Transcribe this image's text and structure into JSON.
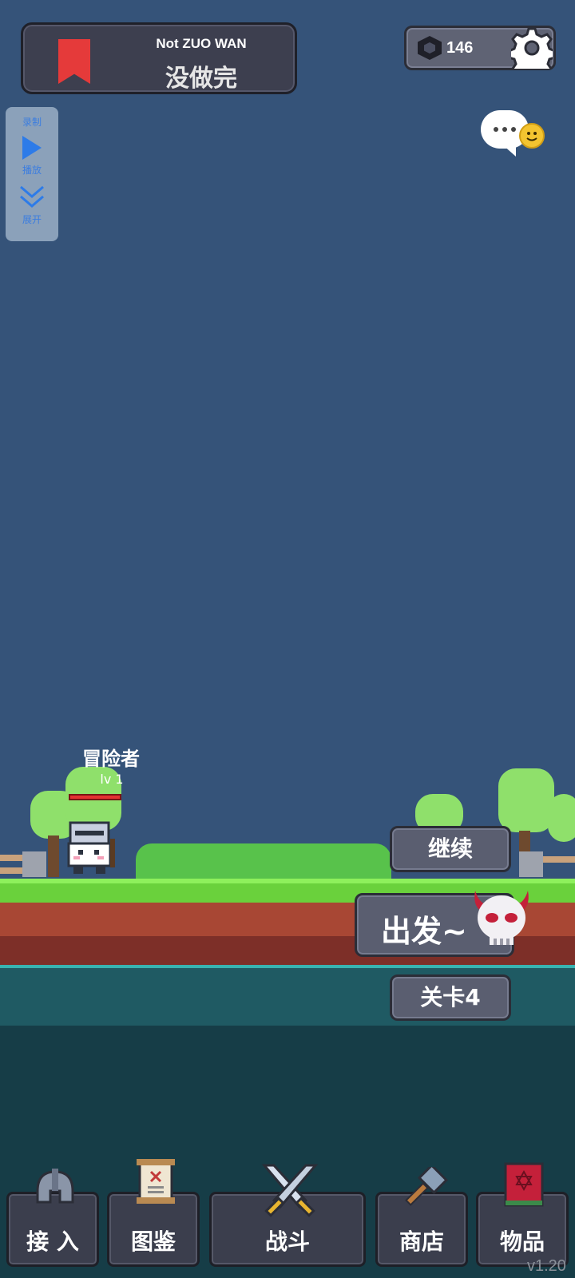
{
  "banner": {
    "subtitle": "Not ZUO WAN",
    "title": "没做完"
  },
  "currency": {
    "count": "146"
  },
  "recorder": {
    "record_label": "录制",
    "play_label": "播放",
    "expand_label": "展开"
  },
  "hero": {
    "name": "冒险者",
    "level": "lv 1"
  },
  "actions": {
    "continue_label": "继续",
    "depart_label": "出发~",
    "level_label": "关卡4"
  },
  "nav": {
    "items": [
      {
        "label": "接 入",
        "icon": "helmet-icon"
      },
      {
        "label": "图鉴",
        "icon": "scroll-icon"
      },
      {
        "label": "战斗",
        "icon": "crossed-swords-icon"
      },
      {
        "label": "商店",
        "icon": "hammer-icon"
      },
      {
        "label": "物品",
        "icon": "spellbook-icon"
      }
    ]
  },
  "version": "v1.20",
  "colors": {
    "sky": "#355379",
    "grass": "#6ad13c",
    "dirt": "#a84734",
    "accent_red": "#e53a3a",
    "button": "#5a5e70"
  }
}
